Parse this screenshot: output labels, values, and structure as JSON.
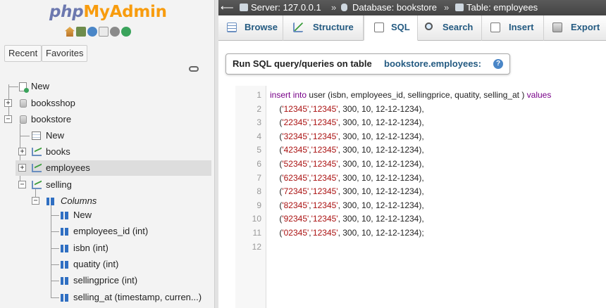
{
  "logo": {
    "php": "php",
    "myadmin": "MyAdmin"
  },
  "nav": {
    "tabs": {
      "recent": "Recent",
      "favorites": "Favorites"
    },
    "tree": {
      "new_top": "New",
      "booksshop": "booksshop",
      "bookstore": "bookstore",
      "bookstore_new": "New",
      "books": "books",
      "employees": "employees",
      "selling": "selling",
      "columns": "Columns",
      "columns_new": "New",
      "col_employees_id": "employees_id (int)",
      "col_isbn": "isbn (int)",
      "col_quatity": "quatity (int)",
      "col_sellingprice": "sellingprice (int)",
      "col_selling_at": "selling_at (timestamp, curren...)"
    }
  },
  "breadcrumb": {
    "server": "Server: 127.0.0.1",
    "database": "Database: bookstore",
    "table": "Table: employees",
    "sep": "»"
  },
  "tabs": {
    "browse": "Browse",
    "structure": "Structure",
    "sql": "SQL",
    "search": "Search",
    "insert": "Insert",
    "export": "Export"
  },
  "sql_panel": {
    "title": "Run SQL query/queries on table",
    "target": "bookstore.employees:"
  },
  "editor": {
    "line_numbers": [
      "1",
      "2",
      "3",
      "4",
      "5",
      "6",
      "7",
      "8",
      "9",
      "10",
      "11",
      "12"
    ],
    "line1": {
      "kw_insert": "insert",
      "kw_into": "into",
      "rest": "user (isbn, employees_id, sellingprice, quatity, selling_at )",
      "kw_values": "values"
    },
    "rows": [
      {
        "a": "'12345'",
        "b": "'12345'",
        "rest": ", 300, 10, 12-12-1234),"
      },
      {
        "a": "'22345'",
        "b": "'12345'",
        "rest": ", 300, 10, 12-12-1234),"
      },
      {
        "a": "'32345'",
        "b": "'12345'",
        "rest": ", 300, 10, 12-12-1234),"
      },
      {
        "a": "'42345'",
        "b": "'12345'",
        "rest": ", 300, 10, 12-12-1234),"
      },
      {
        "a": "'52345'",
        "b": "'12345'",
        "rest": ", 300, 10, 12-12-1234),"
      },
      {
        "a": "'62345'",
        "b": "'12345'",
        "rest": ", 300, 10, 12-12-1234),"
      },
      {
        "a": "'72345'",
        "b": "'12345'",
        "rest": ", 300, 10, 12-12-1234),"
      },
      {
        "a": "'82345'",
        "b": "'12345'",
        "rest": ", 300, 10, 12-12-1234),"
      },
      {
        "a": "'92345'",
        "b": "'12345'",
        "rest": ", 300, 10, 12-12-1234),"
      },
      {
        "a": "'02345'",
        "b": "'12345'",
        "rest": ", 300, 10, 12-12-1234);"
      }
    ]
  },
  "colors": {
    "keyword": "#770088",
    "string": "#aa1111",
    "link": "#235a81",
    "logo_php": "#6c78af",
    "logo_myadmin": "#f89c0e"
  },
  "icons": [
    "home-icon",
    "exit-icon",
    "help-icon",
    "docs-icon",
    "settings-icon",
    "reload-icon",
    "link-icon",
    "database-icon",
    "table-icon",
    "column-icon",
    "new-icon"
  ]
}
